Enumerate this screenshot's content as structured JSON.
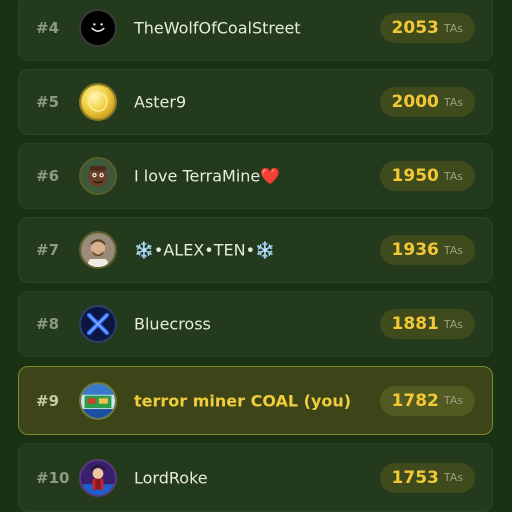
{
  "leaderboard": {
    "unit": "TAs",
    "entries": [
      {
        "rank": "#4",
        "name": "TheWolfOfCoalStreet",
        "score": "2053",
        "avatar_icon": "smiley-face-avatar-icon"
      },
      {
        "rank": "#5",
        "name": "Aster9",
        "score": "2000",
        "avatar_icon": "gold-coin-avatar-icon"
      },
      {
        "rank": "#6",
        "name": "I love TerraMine",
        "name_suffix": "❤️",
        "score": "1950",
        "avatar_icon": "character-avatar-icon"
      },
      {
        "rank": "#7",
        "name": "❄️•ALEX•TEN•❄️",
        "score": "1936",
        "avatar_icon": "person-photo-avatar-icon"
      },
      {
        "rank": "#8",
        "name": "Bluecross",
        "score": "1881",
        "avatar_icon": "blue-x-avatar-icon"
      },
      {
        "rank": "#9",
        "name": "terror miner COAL (you)",
        "score": "1782",
        "avatar_icon": "game-art-avatar-icon",
        "current_user": true
      },
      {
        "rank": "#10",
        "name": "LordRoke",
        "score": "1753",
        "avatar_icon": "anime-character-avatar-icon"
      }
    ]
  },
  "colors": {
    "background": "#1b3114",
    "row": "#233a1c",
    "highlight_row": "#3d4518",
    "score": "#f2c935",
    "you_name": "#f0cd3c"
  }
}
